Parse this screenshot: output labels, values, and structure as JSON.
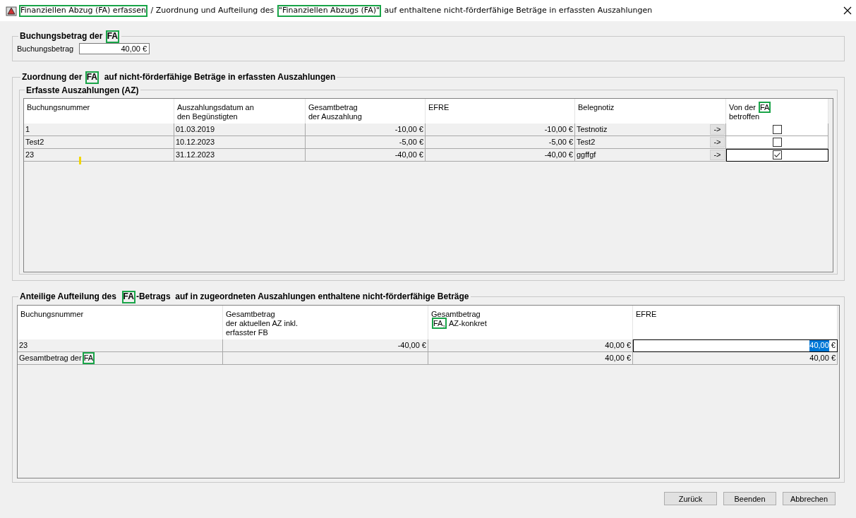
{
  "window": {
    "title": [
      {
        "text": "Finanziellen Abzug (FA) erfassen",
        "highlighted": true
      },
      {
        "text": " / Zuordnung und Aufteilung des ",
        "highlighted": false
      },
      {
        "text": "\"Finanziellen Abzugs (FA)\"",
        "highlighted": true
      },
      {
        "text": " auf enthaltene nicht-förderfähige Beträge in erfassten Auszahlungen",
        "highlighted": false
      }
    ]
  },
  "booking": {
    "legend": [
      {
        "text": "Buchungsbetrag der ",
        "highlighted": false
      },
      {
        "text": "FA",
        "highlighted": true
      }
    ],
    "label": "Buchungsbetrag",
    "value": "40,00 €"
  },
  "assignment": {
    "legend": [
      {
        "text": "Zuordnung der ",
        "highlighted": false
      },
      {
        "text": "FA",
        "highlighted": true
      },
      {
        "text": "  auf nicht-förderfähige Beträge in erfassten Auszahlungen",
        "highlighted": false
      }
    ],
    "payments": {
      "legend": "Erfasste Auszahlungen (AZ)",
      "columns": [
        [
          {
            "text": "Buchungsnummer",
            "highlighted": false
          }
        ],
        [
          {
            "text": "Auszahlungsdatum an\nden Begünstigten",
            "highlighted": false
          }
        ],
        [
          {
            "text": "Gesamtbetrag\nder Auszahlung",
            "highlighted": false
          }
        ],
        [
          {
            "text": "EFRE",
            "highlighted": false
          }
        ],
        [
          {
            "text": "Belegnotiz",
            "highlighted": false
          }
        ],
        [
          {
            "text": "Von der ",
            "highlighted": false
          },
          {
            "text": "FA",
            "highlighted": true
          },
          {
            "text": "\nbetroffen",
            "highlighted": false
          }
        ]
      ],
      "rows": [
        {
          "number": "1",
          "date": "01.03.2019",
          "total": "-10,00 €",
          "efre": "-10,00 €",
          "note": "Testnotiz",
          "button": "->",
          "checked": false,
          "focused": false
        },
        {
          "number": "Test2",
          "date": "10.12.2023",
          "total": "-5,00 €",
          "efre": "-5,00 €",
          "note": "Test2",
          "button": "->",
          "checked": false,
          "focused": false
        },
        {
          "number": "23",
          "date": "31.12.2023",
          "total": "-40,00 €",
          "efre": "-40,00 €",
          "note": "ggffgf",
          "button": "->",
          "checked": true,
          "focused": true
        }
      ]
    }
  },
  "split": {
    "legend": [
      {
        "text": "Anteilige Aufteilung des  ",
        "highlighted": false
      },
      {
        "text": "FA",
        "highlighted": true
      },
      {
        "text": "-Betrags  auf in zugeordneten Auszahlungen enthaltene nicht-förderfähige Beträge",
        "highlighted": false
      }
    ],
    "columns": [
      [
        {
          "text": "Buchungsnummer",
          "highlighted": false
        }
      ],
      [
        {
          "text": "Gesamtbetrag\nder aktuellen AZ inkl.\nerfasster FB",
          "highlighted": false
        }
      ],
      [
        {
          "text": "Gesamtbetrag\n",
          "highlighted": false
        },
        {
          "text": "FA,",
          "highlighted": true
        },
        {
          "text": " AZ-konkret",
          "highlighted": false
        }
      ],
      [
        {
          "text": "EFRE",
          "highlighted": false
        }
      ]
    ],
    "rows": [
      {
        "kind": "entry",
        "number": "23",
        "total": "-40,00 €",
        "fa_amount": "40,00 €",
        "efre": {
          "value": "40,00",
          "unit": "€",
          "selected": true
        }
      },
      {
        "kind": "sum",
        "label": [
          {
            "text": "Gesamtbetrag der ",
            "highlighted": false
          },
          {
            "text": "FA",
            "highlighted": true
          }
        ],
        "fa_amount": "40,00 €",
        "efre": "40,00 €"
      }
    ]
  },
  "buttons": [
    "Zurück",
    "Beenden",
    "Abbrechen"
  ]
}
